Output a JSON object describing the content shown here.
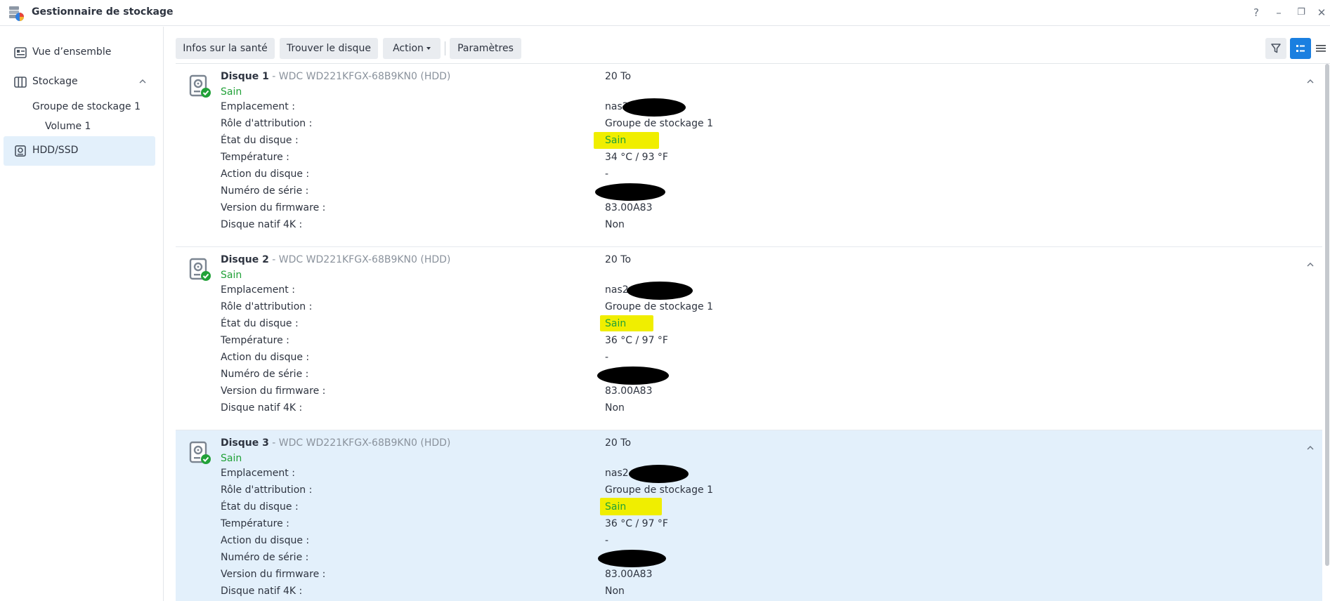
{
  "window": {
    "title": "Gestionnaire de stockage",
    "controls": [
      "?",
      "–",
      "❐",
      "✕"
    ]
  },
  "sidebar": {
    "overview": "Vue d’ensemble",
    "storage": "Stockage",
    "storage_group": "Groupe de stockage 1",
    "volume": "Volume 1",
    "hdd": "HDD/SSD"
  },
  "toolbar": {
    "health": "Infos sur la santé",
    "find": "Trouver le disque",
    "action": "Action",
    "settings": "Paramètres"
  },
  "colors": {
    "accent": "#1a7fe0",
    "healthy": "#21a138",
    "highlight": "#f0ee00",
    "selected_row": "#e3f0fb"
  },
  "labels": {
    "location": "Emplacement :",
    "role": "Rôle d'attribution :",
    "state": "État du disque :",
    "temperature": "Température :",
    "action": "Action du disque :",
    "serial": "Numéro de série :",
    "firmware": "Version du firmware :",
    "native4k": "Disque natif 4K :"
  },
  "disks": [
    {
      "name": "Disque 1",
      "model": " - WDC WD221KFGX-68B9KN0 (HDD)",
      "status": "Sain",
      "size": "20 To",
      "location": "nas2",
      "role": "Groupe de stockage 1",
      "state": "Sain",
      "temperature": "34 °C / 93 °F",
      "action": "-",
      "serial": "",
      "firmware": "83.00A83",
      "native4k": "Non"
    },
    {
      "name": "Disque 2",
      "model": " - WDC WD221KFGX-68B9KN0 (HDD)",
      "status": "Sain",
      "size": "20 To",
      "location": "nas2",
      "role": "Groupe de stockage 1",
      "state": "Sain",
      "temperature": "36 °C / 97 °F",
      "action": "-",
      "serial": "",
      "firmware": "83.00A83",
      "native4k": "Non"
    },
    {
      "name": "Disque 3",
      "model": " - WDC WD221KFGX-68B9KN0 (HDD)",
      "status": "Sain",
      "size": "20 To",
      "location": "nas2-",
      "role": "Groupe de stockage 1",
      "state": "Sain",
      "temperature": "36 °C / 97 °F",
      "action": "-",
      "serial": "",
      "firmware": "83.00A83",
      "native4k": "Non"
    }
  ]
}
